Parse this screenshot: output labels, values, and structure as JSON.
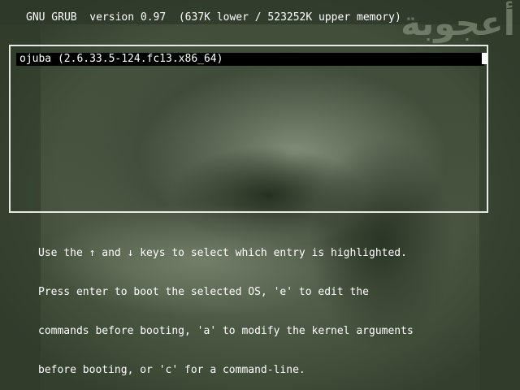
{
  "header": {
    "title": "GNU GRUB  version 0.97  (637K lower / 523252K upper memory)"
  },
  "logo_text": "أعجوبة",
  "menu": {
    "entries": [
      {
        "label": "ojuba (2.6.33.5-124.fc13.x86_64)",
        "selected": true
      }
    ]
  },
  "help": {
    "lines": [
      "Use the ↑ and ↓ keys to select which entry is highlighted.",
      "Press enter to boot the selected OS, 'e' to edit the",
      "commands before booting, 'a' to modify the kernel arguments",
      "before booting, or 'c' for a command-line."
    ]
  },
  "colors": {
    "background": "#43503d",
    "text": "#ffffff",
    "selection_bg": "#000000",
    "border": "#e8e8e8"
  }
}
